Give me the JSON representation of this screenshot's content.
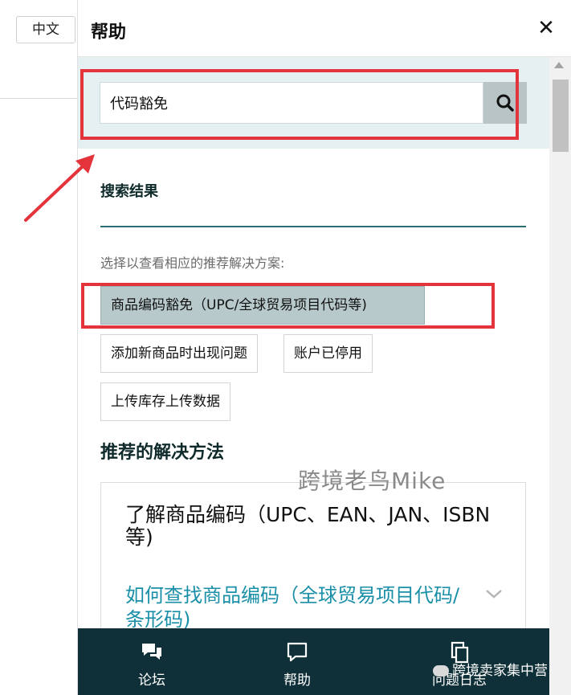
{
  "background_page": {
    "language_button": "中文"
  },
  "help_panel": {
    "title": "帮助",
    "close_symbol": "✕",
    "search": {
      "value": "代码豁免",
      "icon": "search-icon"
    },
    "results": {
      "heading": "搜索结果",
      "hint": "选择以查看相应的推荐解决方案:",
      "chips": [
        {
          "label": "商品编码豁免（UPC/全球贸易项目代码等)",
          "selected": true
        },
        {
          "label": "添加新商品时出现问题",
          "selected": false
        },
        {
          "label": "账户已停用",
          "selected": false
        },
        {
          "label": "上传库存上传数据",
          "selected": false
        }
      ]
    },
    "recommended": {
      "heading": "推荐的解决方法",
      "card": {
        "title": "了解商品编码（UPC、EAN、JAN、ISBN 等)",
        "link": "如何查找商品编码（全球贸易项目代码/条形码)"
      }
    },
    "bottom_nav": [
      {
        "label": "论坛",
        "icon": "forum-icon"
      },
      {
        "label": "帮助",
        "icon": "help-chat-icon"
      },
      {
        "label": "问题日志",
        "icon": "case-log-icon"
      }
    ]
  },
  "watermarks": {
    "center": "跨境老鸟Mike",
    "corner": "跨境卖家集中营"
  },
  "colors": {
    "search_band": "#e6f0f2",
    "selected_chip": "#b8c9cb",
    "annotation_red": "#e3343c",
    "link_teal": "#1a8fa8",
    "bottom_bar": "#0f3038"
  }
}
